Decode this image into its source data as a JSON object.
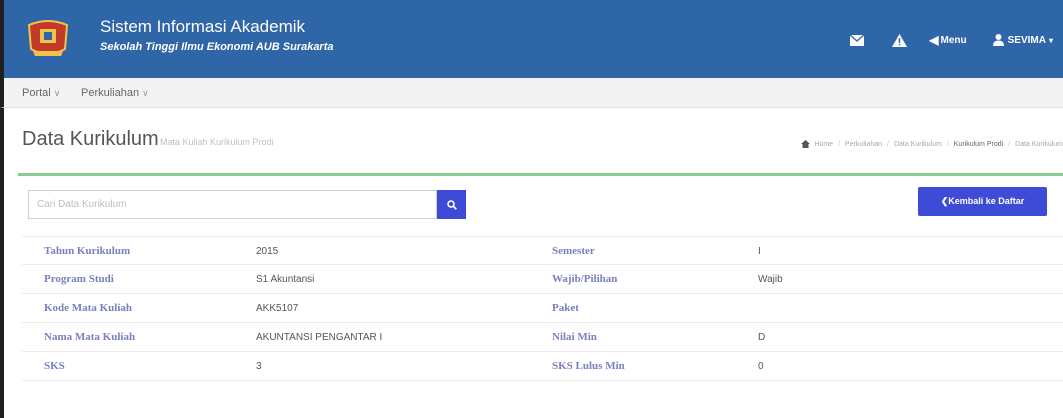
{
  "header": {
    "title": "Sistem Informasi Akademik",
    "subtitle": "Sekolah Tinggi Ilmu Ekonomi AUB Surakarta",
    "menu_label": "Menu",
    "user_label": "SEVIMA",
    "colors": {
      "bar": "#2f66a8",
      "accent": "#3d4bd6"
    }
  },
  "nav": {
    "items": [
      {
        "label": "Portal"
      },
      {
        "label": "Perkuliahan"
      }
    ]
  },
  "page": {
    "title": "Data Kurikulum",
    "subtitle": "Mata Kuliah Kurikulum Prodi",
    "breadcrumb": [
      "Home",
      "Perkuliahan",
      "Data Kurikulum",
      "Kurikulum Prodi",
      "Data Kurikulum"
    ]
  },
  "search": {
    "placeholder": "Cari Data Kurikulum",
    "value": ""
  },
  "actions": {
    "back_label": "Kembali ke Daftar"
  },
  "details": [
    {
      "label_left": "Tahun Kurikulum",
      "value_left": "2015",
      "label_right": "Semester",
      "value_right": "I"
    },
    {
      "label_left": "Program Studi",
      "value_left": "S1 Akuntansi",
      "label_right": "Wajib/Pilihan",
      "value_right": "Wajib"
    },
    {
      "label_left": "Kode Mata Kuliah",
      "value_left": "AKK5107",
      "label_right": "Paket",
      "value_right": ""
    },
    {
      "label_left": "Nama Mata Kuliah",
      "value_left": "AKUNTANSI PENGANTAR I",
      "label_right": "Nilai Min",
      "value_right": "D"
    },
    {
      "label_left": "SKS",
      "value_left": "3",
      "label_right": "SKS Lulus Min",
      "value_right": "0"
    }
  ],
  "icons": [
    "logo",
    "mail-icon",
    "warning-icon",
    "menu-arrow-icon",
    "user-icon",
    "caret-down-icon",
    "home-icon",
    "search-icon",
    "chevron-left-icon"
  ]
}
